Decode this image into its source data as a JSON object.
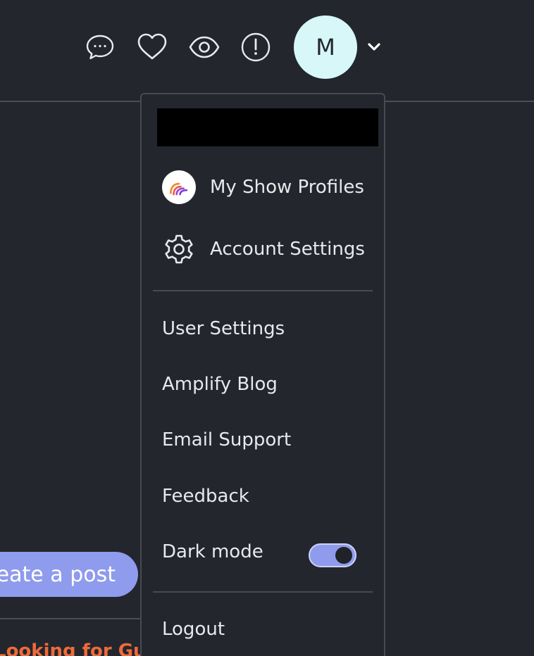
{
  "header": {
    "avatar_initial": "M",
    "icons": [
      "chat-icon",
      "heart-icon",
      "eye-icon",
      "alert-icon",
      "chevron-down-icon"
    ]
  },
  "background": {
    "create_post_label": "Create a post",
    "post_title": "Looking for Gu"
  },
  "menu": {
    "show_profiles_label": "My Show Profiles",
    "account_settings_label": "Account Settings",
    "user_settings_label": "User Settings",
    "blog_label": "Amplify Blog",
    "email_support_label": "Email Support",
    "feedback_label": "Feedback",
    "dark_mode_label": "Dark mode",
    "dark_mode_on": true,
    "logout_label": "Logout"
  },
  "colors": {
    "background": "#23262d",
    "accent": "#8f9bec",
    "avatar_bg": "#d7f7f9",
    "post_title": "#ef6a3a"
  }
}
